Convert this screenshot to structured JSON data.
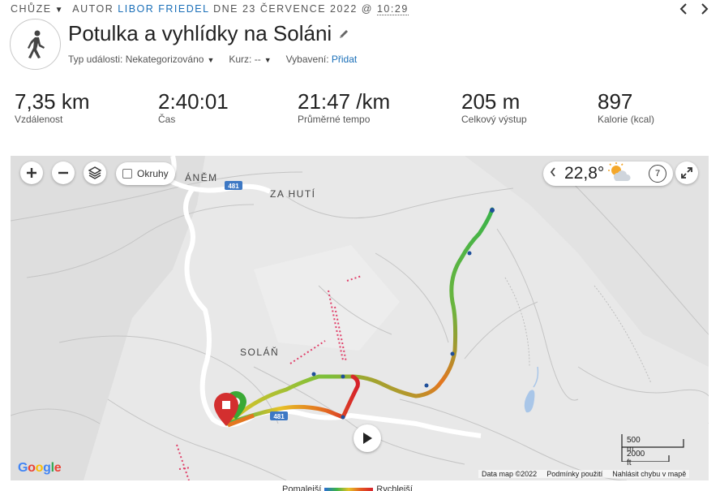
{
  "header": {
    "activity_type": "CHŮZE",
    "author_prefix": "AUTOR",
    "author": "LIBOR FRIEDEL",
    "date_prefix": "DNE 23 ČERVENCE 2022 @",
    "time": "10:29"
  },
  "title": "Potulka a vyhlídky na Soláni",
  "meta": {
    "event_type_label": "Typ události: Nekategorizováno",
    "course_label": "Kurz: --",
    "gear_label": "Vybavení:",
    "gear_link": "Přidat"
  },
  "stats": [
    {
      "value": "7,35 km",
      "label": "Vzdálenost"
    },
    {
      "value": "2:40:01",
      "label": "Čas"
    },
    {
      "value": "21:47 /km",
      "label": "Průměrné tempo"
    },
    {
      "value": "205 m",
      "label": "Celkový výstup"
    },
    {
      "value": "897",
      "label": "Kalorie (kcal)"
    }
  ],
  "map": {
    "okruhy_label": "Okruhy",
    "temperature": "22,8°",
    "weather_badge": "7",
    "place_labels": {
      "zahuti": "ZA HUTÍ",
      "solan": "SOLÁŇ",
      "anem": "ÁNĚM"
    },
    "road_number": "481",
    "google_logo": "Google",
    "footer": {
      "data": "Data map ©2022",
      "terms": "Podmínky použití",
      "report": "Nahlásit chybu v mapě"
    },
    "scale": {
      "metric": "500 m",
      "imperial": "2000 ft"
    },
    "icons": {
      "zoom_in": "plus-icon",
      "zoom_out": "minus-icon",
      "layers": "layers-icon",
      "weather": "partly-sunny-icon",
      "fullscreen": "expand-icon",
      "play": "play-icon",
      "start": "start-marker-icon",
      "finish": "finish-marker-icon"
    }
  },
  "legend": {
    "left": "Pomalejší",
    "right": "Rychlejší"
  },
  "colors": {
    "link": "#1a6fb8",
    "finish_marker": "#d32f2f",
    "start_marker": "#3aa935"
  }
}
